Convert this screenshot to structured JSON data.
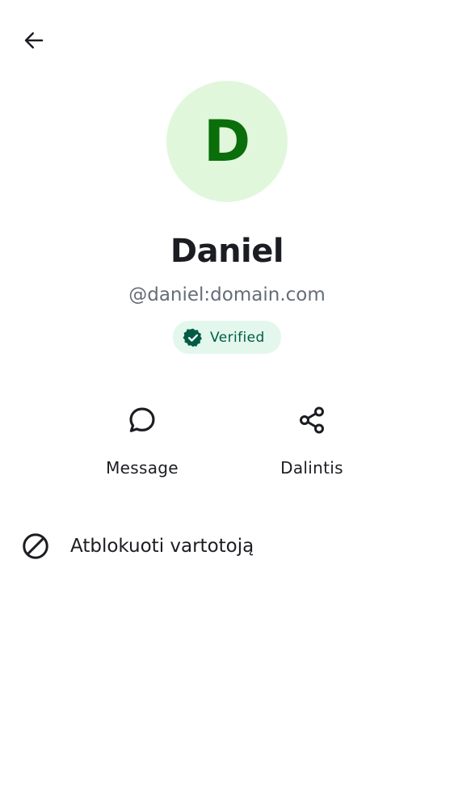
{
  "header": {
    "back_icon": "arrow-left-icon"
  },
  "profile": {
    "avatar_letter": "D",
    "avatar_bg": "#e0f7dc",
    "avatar_fg": "#0a6e0a",
    "display_name": "Daniel",
    "user_id": "@daniel:domain.com",
    "verified_label": "Verified",
    "verified_icon": "verified-check-icon",
    "verified_color": "#005c45"
  },
  "actions": [
    {
      "label": "Message",
      "icon": "chat-bubble-icon"
    },
    {
      "label": "Dalintis",
      "icon": "share-icon"
    }
  ],
  "list": {
    "block_label": "Atblokuoti vartotoją",
    "block_icon": "block-icon"
  }
}
